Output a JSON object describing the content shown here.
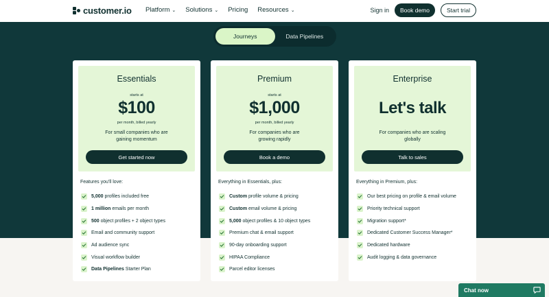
{
  "nav": {
    "logo_text": "customer.io",
    "menu": [
      {
        "label": "Platform",
        "has_dropdown": true
      },
      {
        "label": "Solutions",
        "has_dropdown": true
      },
      {
        "label": "Pricing",
        "has_dropdown": false
      },
      {
        "label": "Resources",
        "has_dropdown": true
      }
    ],
    "sign_in": "Sign in",
    "book_demo": "Book demo",
    "start_trial": "Start trial"
  },
  "toggle": {
    "options": [
      "Journeys",
      "Data Pipelines"
    ],
    "active": "Journeys"
  },
  "plans": [
    {
      "name": "Essentials",
      "starts_at": "starts at",
      "price": "$100",
      "period": "per month, billed yearly",
      "description": "For small companies who are gaining momentum",
      "cta": "Get started now",
      "features_heading": "Features you'll love:",
      "features": [
        {
          "bold": "5,000",
          "text": " profiles included free"
        },
        {
          "bold": "1 million",
          "text": " emails per month"
        },
        {
          "bold": "500",
          "text": " object profiles + 2 object types"
        },
        {
          "bold": "",
          "text": "Email and community support"
        },
        {
          "bold": "",
          "text": "Ad audience sync"
        },
        {
          "bold": "",
          "text": "Visual workflow builder"
        },
        {
          "bold": "Data Pipelines",
          "text": " Starter Plan"
        }
      ]
    },
    {
      "name": "Premium",
      "starts_at": "starts at",
      "price": "$1,000",
      "period": "per month, billed yearly",
      "description": "For companies who are growing rapidly",
      "cta": "Book a demo",
      "features_heading": "Everything in Essentials, plus:",
      "features": [
        {
          "bold": "Custom",
          "text": " profile volume & pricing"
        },
        {
          "bold": "Custom",
          "text": " email volume & pricing"
        },
        {
          "bold": "5,000",
          "text": " object profiles & 10 object types"
        },
        {
          "bold": "",
          "text": "Premium chat & email support"
        },
        {
          "bold": "",
          "text": "90-day onboarding support"
        },
        {
          "bold": "",
          "text": "HIPAA Compliance"
        },
        {
          "bold": "",
          "text": "Parcel editor licenses"
        }
      ]
    },
    {
      "name": "Enterprise",
      "headline": "Let's talk",
      "description": "For companies who are scaling globally",
      "cta": "Talk to sales",
      "features_heading": "Everything in Premium, plus:",
      "features": [
        {
          "bold": "",
          "text": "Our best pricing on profile & email volume"
        },
        {
          "bold": "",
          "text": "Priority technical support"
        },
        {
          "bold": "",
          "text": "Migration support*"
        },
        {
          "bold": "",
          "text": "Dedicated Customer Success Manager*"
        },
        {
          "bold": "",
          "text": "Dedicated hardware"
        },
        {
          "bold": "",
          "text": "Audit logging & data governance"
        }
      ]
    }
  ],
  "chat": {
    "label": "Chat now",
    "icon": "chat-bubble-icon"
  },
  "colors": {
    "brand_dark": "#10302f",
    "band": "#10383a",
    "mint": "#e4f6d7",
    "check_bg": "#daf3cb",
    "chat_green": "#1f7a62"
  }
}
